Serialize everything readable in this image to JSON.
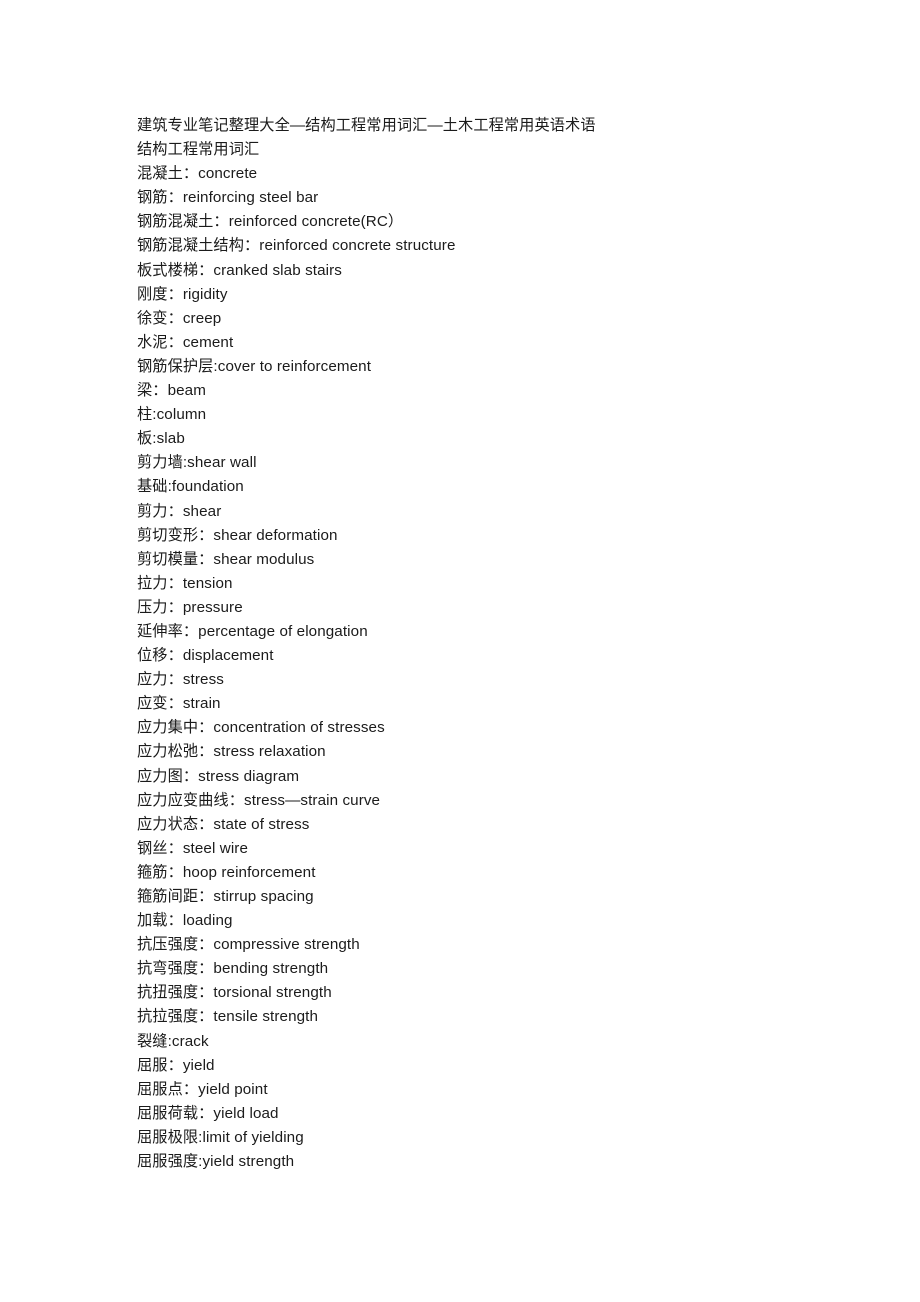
{
  "document": {
    "title": "建筑专业笔记整理大全—结构工程常用词汇—土木工程常用英语术语",
    "section_heading": "结构工程常用词汇",
    "page_background": "#ffffff",
    "text_color": "#1b1b1b",
    "lines": [
      "建筑专业笔记整理大全—结构工程常用词汇—土木工程常用英语术语",
      "结构工程常用词汇",
      "混凝土：concrete",
      "钢筋：reinforcing steel bar",
      "钢筋混凝土：reinforced concrete(RC）",
      "钢筋混凝土结构：reinforced concrete structure",
      "板式楼梯：cranked slab stairs",
      "刚度：rigidity",
      "徐变：creep",
      "水泥：cement",
      "钢筋保护层:cover to reinforcement",
      "梁：beam",
      "柱:column",
      "板:slab",
      "剪力墙:shear wall",
      "基础:foundation",
      "剪力：shear",
      "剪切变形：shear deformation",
      "剪切模量：shear modulus",
      "拉力：tension",
      "压力：pressure",
      "延伸率：percentage of elongation",
      "位移：displacement",
      "应力：stress",
      "应变：strain",
      "应力集中：concentration of stresses",
      "应力松弛：stress relaxation",
      "应力图：stress diagram",
      "应力应变曲线：stress—strain curve",
      "应力状态：state of stress",
      "钢丝：steel wire",
      "箍筋：hoop reinforcement",
      "箍筋间距：stirrup spacing",
      "加载：loading",
      "抗压强度：compressive strength",
      "抗弯强度：bending strength",
      "抗扭强度：torsional strength",
      "抗拉强度：tensile strength",
      "裂缝:crack",
      "屈服：yield",
      "屈服点：yield point",
      "屈服荷载：yield load",
      "屈服极限:limit of yielding",
      "屈服强度:yield strength"
    ]
  }
}
